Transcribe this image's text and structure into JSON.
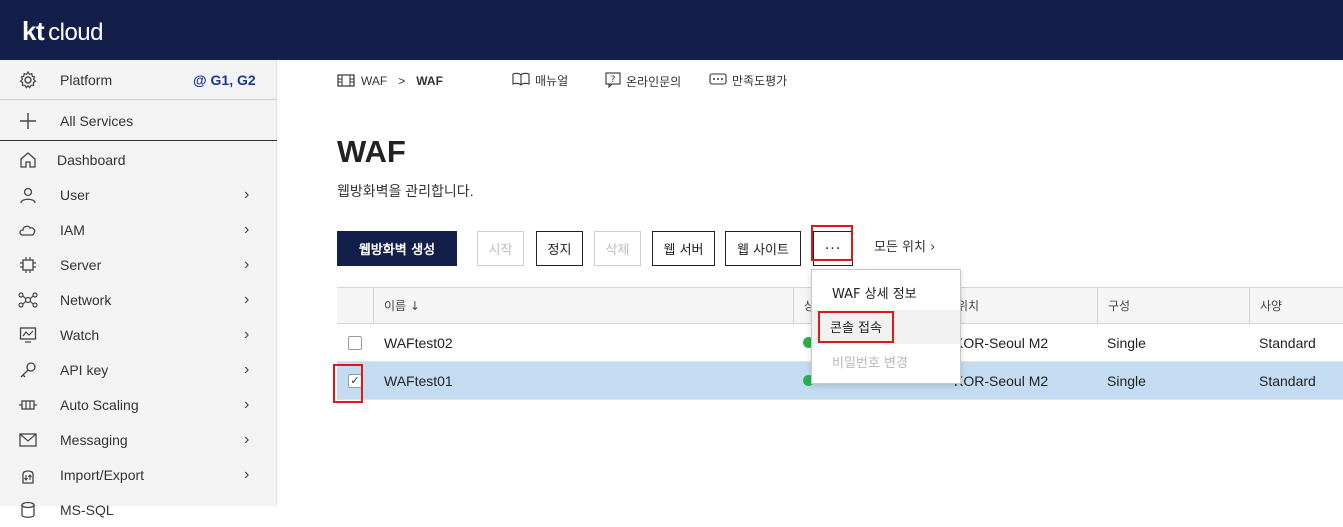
{
  "brand": {
    "kt": "kt",
    "cloud": "cloud"
  },
  "sidebar": {
    "platform_label": "Platform",
    "platform_group": "@ G1, G2",
    "all_services": "All Services",
    "items": [
      {
        "label": "Dashboard",
        "icon": "home-icon",
        "arrow": ""
      },
      {
        "label": "User",
        "icon": "user-icon",
        "arrow": "›"
      },
      {
        "label": "IAM",
        "icon": "cloud-icon",
        "arrow": "›"
      },
      {
        "label": "Server",
        "icon": "chip-icon",
        "arrow": "›"
      },
      {
        "label": "Network",
        "icon": "network-icon",
        "arrow": "›"
      },
      {
        "label": "Watch",
        "icon": "monitor-icon",
        "arrow": "›"
      },
      {
        "label": "API key",
        "icon": "key-icon",
        "arrow": "›"
      },
      {
        "label": "Auto Scaling",
        "icon": "scaling-icon",
        "arrow": "›"
      },
      {
        "label": "Messaging",
        "icon": "mail-icon",
        "arrow": "›"
      },
      {
        "label": "Import/Export",
        "icon": "import-export-icon",
        "arrow": "›"
      },
      {
        "label": "MS-SQL",
        "icon": "database-icon",
        "arrow": ""
      }
    ]
  },
  "breadcrumb": {
    "first": "WAF",
    "sep": ">",
    "current": "WAF"
  },
  "tools": {
    "manual": "매뉴얼",
    "inquiry": "온라인문의",
    "survey": "만족도평가"
  },
  "page": {
    "title": "WAF",
    "subtitle": "웹방화벽을 관리합니다."
  },
  "toolbar": {
    "create": "웹방화벽 생성",
    "start": "시작",
    "stop": "정지",
    "delete": "삭제",
    "web_server": "웹 서버",
    "web_site": "웹 사이트",
    "more": "···",
    "all_locations": "모든 위치 ›"
  },
  "table": {
    "headers": {
      "name": "이름 ↓",
      "status": "상",
      "location": "위치",
      "config": "구성",
      "spec": "사양"
    },
    "rows": [
      {
        "name": "WAFtest02",
        "location": "KOR-Seoul M2",
        "config": "Single",
        "spec": "Standard",
        "checked": false
      },
      {
        "name": "WAFtest01",
        "location": "KOR-Seoul M2",
        "config": "Single",
        "spec": "Standard",
        "checked": true
      }
    ]
  },
  "dropdown": {
    "items": [
      "WAF 상세 정보",
      "콘솔 접속",
      "비밀번호 변경"
    ]
  },
  "colors": {
    "header_bg": "#141e4b",
    "primary": "#141e4b",
    "selected_row": "#c4dcf1",
    "status_ok": "#2bb24c",
    "highlight": "#e0161b"
  }
}
